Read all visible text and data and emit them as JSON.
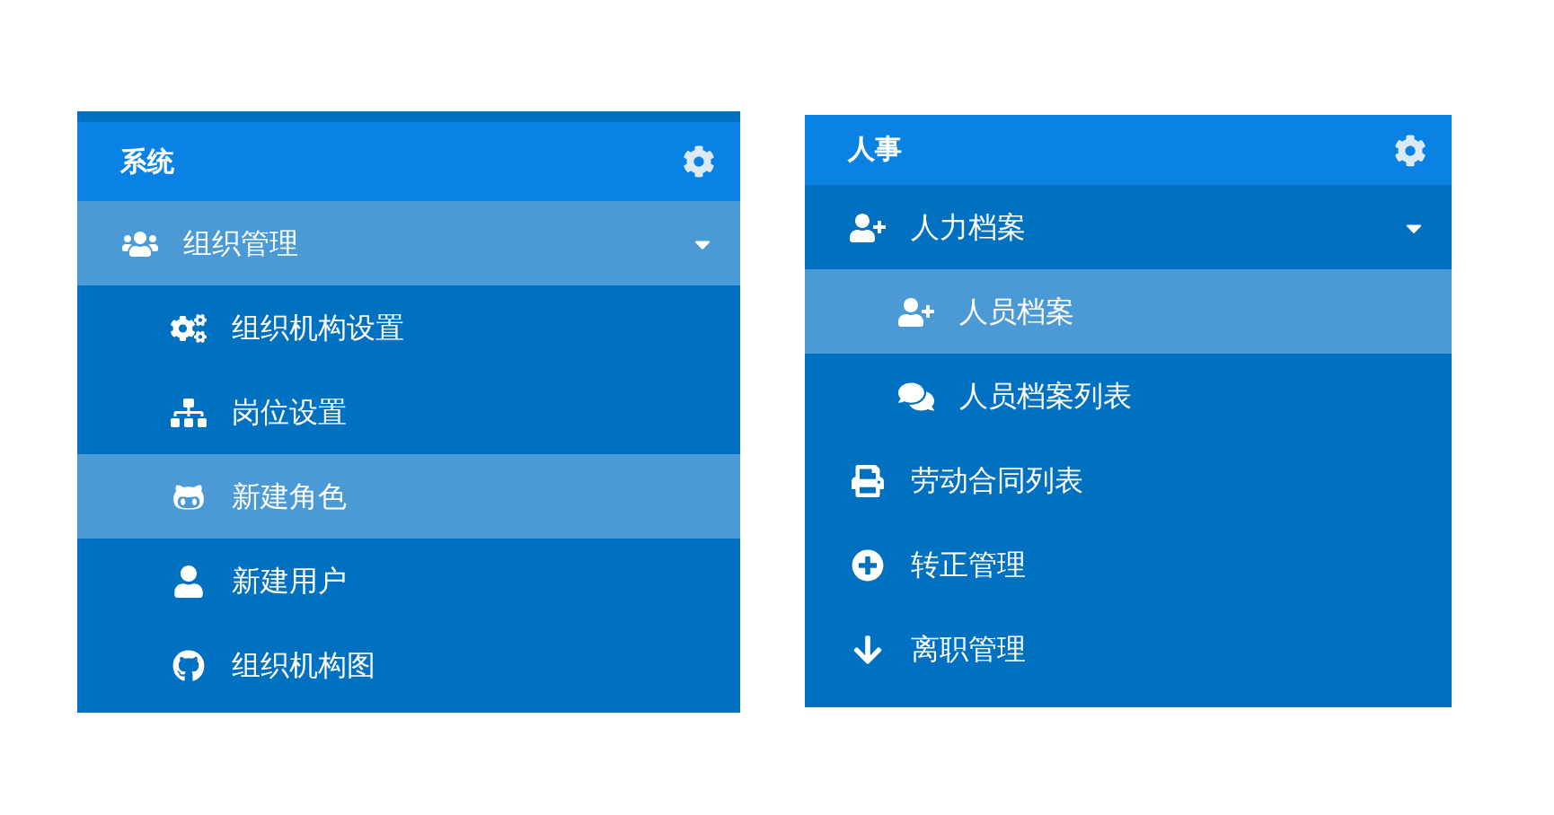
{
  "panels": [
    {
      "title": "系统",
      "items": [
        {
          "label": "组织管理",
          "selected": true,
          "expanded": true,
          "children": [
            {
              "label": "组织机构设置",
              "selected": false
            },
            {
              "label": "岗位设置",
              "selected": false
            },
            {
              "label": "新建角色",
              "selected": true
            },
            {
              "label": "新建用户",
              "selected": false
            },
            {
              "label": "组织机构图",
              "selected": false
            }
          ]
        }
      ]
    },
    {
      "title": "人事",
      "items": [
        {
          "label": "人力档案",
          "selected": false,
          "expanded": true,
          "children": [
            {
              "label": "人员档案",
              "selected": true
            },
            {
              "label": "人员档案列表",
              "selected": false
            }
          ]
        },
        {
          "label": "劳动合同列表",
          "selected": false
        },
        {
          "label": "转正管理",
          "selected": false
        },
        {
          "label": "离职管理",
          "selected": false
        }
      ]
    }
  ]
}
